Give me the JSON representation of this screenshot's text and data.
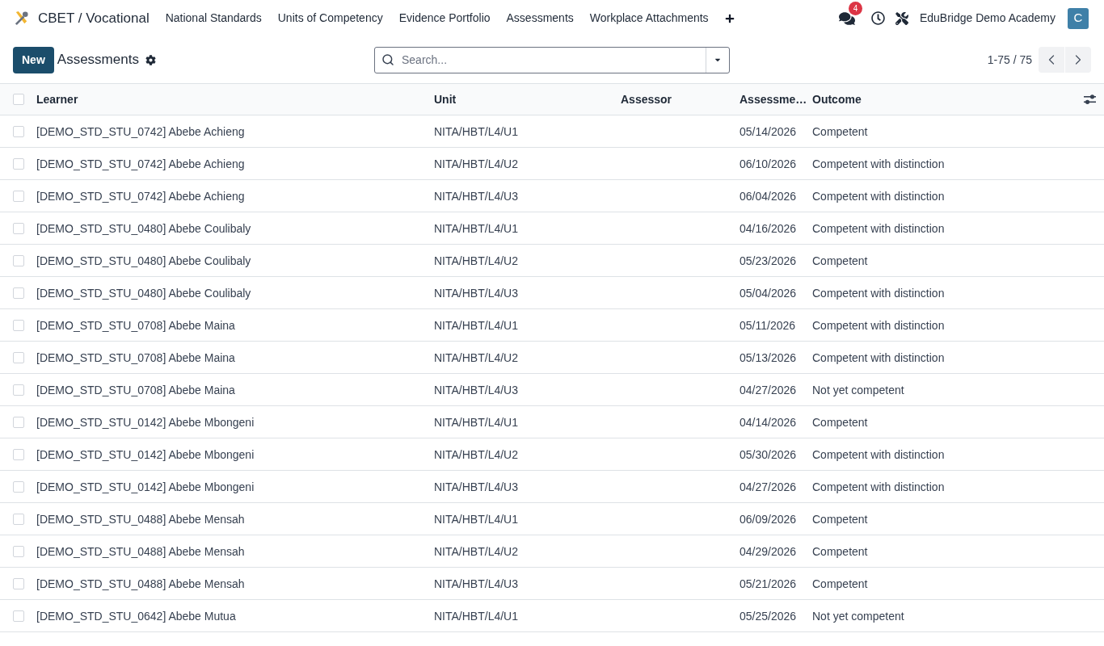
{
  "navbar": {
    "app_name": "CBET / Vocational",
    "menu": [
      {
        "label": "National Standards"
      },
      {
        "label": "Units of Competency"
      },
      {
        "label": "Evidence Portfolio"
      },
      {
        "label": "Assessments"
      },
      {
        "label": "Workplace Attachments"
      }
    ],
    "messages_badge": "4",
    "company": "EduBridge Demo Academy",
    "avatar_initial": "C"
  },
  "control_panel": {
    "new_button": "New",
    "title": "Assessments",
    "search": {
      "placeholder": "Search..."
    },
    "pager": "1-75 / 75"
  },
  "table": {
    "all_checked": false,
    "columns": [
      {
        "label": "Learner"
      },
      {
        "label": "Unit"
      },
      {
        "label": "Assessor"
      },
      {
        "label": "Assessme…"
      },
      {
        "label": "Outcome"
      }
    ],
    "rows": [
      {
        "checked": false,
        "learner": "[DEMO_STD_STU_0742] Abebe Achieng",
        "unit": "NITA/HBT/L4/U1",
        "date": "05/14/2026",
        "outcome": "Competent"
      },
      {
        "checked": false,
        "learner": "[DEMO_STD_STU_0742] Abebe Achieng",
        "unit": "NITA/HBT/L4/U2",
        "date": "06/10/2026",
        "outcome": "Competent with distinction"
      },
      {
        "checked": false,
        "learner": "[DEMO_STD_STU_0742] Abebe Achieng",
        "unit": "NITA/HBT/L4/U3",
        "date": "06/04/2026",
        "outcome": "Competent with distinction"
      },
      {
        "checked": false,
        "learner": "[DEMO_STD_STU_0480] Abebe Coulibaly",
        "unit": "NITA/HBT/L4/U1",
        "date": "04/16/2026",
        "outcome": "Competent with distinction"
      },
      {
        "checked": false,
        "learner": "[DEMO_STD_STU_0480] Abebe Coulibaly",
        "unit": "NITA/HBT/L4/U2",
        "date": "05/23/2026",
        "outcome": "Competent"
      },
      {
        "checked": false,
        "learner": "[DEMO_STD_STU_0480] Abebe Coulibaly",
        "unit": "NITA/HBT/L4/U3",
        "date": "05/04/2026",
        "outcome": "Competent with distinction"
      },
      {
        "checked": false,
        "learner": "[DEMO_STD_STU_0708] Abebe Maina",
        "unit": "NITA/HBT/L4/U1",
        "date": "05/11/2026",
        "outcome": "Competent with distinction"
      },
      {
        "checked": false,
        "learner": "[DEMO_STD_STU_0708] Abebe Maina",
        "unit": "NITA/HBT/L4/U2",
        "date": "05/13/2026",
        "outcome": "Competent with distinction"
      },
      {
        "checked": false,
        "learner": "[DEMO_STD_STU_0708] Abebe Maina",
        "unit": "NITA/HBT/L4/U3",
        "date": "04/27/2026",
        "outcome": "Not yet competent"
      },
      {
        "checked": false,
        "learner": "[DEMO_STD_STU_0142] Abebe Mbongeni",
        "unit": "NITA/HBT/L4/U1",
        "date": "04/14/2026",
        "outcome": "Competent"
      },
      {
        "checked": false,
        "learner": "[DEMO_STD_STU_0142] Abebe Mbongeni",
        "unit": "NITA/HBT/L4/U2",
        "date": "05/30/2026",
        "outcome": "Competent with distinction"
      },
      {
        "checked": false,
        "learner": "[DEMO_STD_STU_0142] Abebe Mbongeni",
        "unit": "NITA/HBT/L4/U3",
        "date": "04/27/2026",
        "outcome": "Competent with distinction"
      },
      {
        "checked": false,
        "learner": "[DEMO_STD_STU_0488] Abebe Mensah",
        "unit": "NITA/HBT/L4/U1",
        "date": "06/09/2026",
        "outcome": "Competent"
      },
      {
        "checked": false,
        "learner": "[DEMO_STD_STU_0488] Abebe Mensah",
        "unit": "NITA/HBT/L4/U2",
        "date": "04/29/2026",
        "outcome": "Competent"
      },
      {
        "checked": false,
        "learner": "[DEMO_STD_STU_0488] Abebe Mensah",
        "unit": "NITA/HBT/L4/U3",
        "date": "05/21/2026",
        "outcome": "Competent"
      },
      {
        "checked": false,
        "learner": "[DEMO_STD_STU_0642] Abebe Mutua",
        "unit": "NITA/HBT/L4/U1",
        "date": "05/25/2026",
        "outcome": "Not yet competent"
      }
    ]
  }
}
